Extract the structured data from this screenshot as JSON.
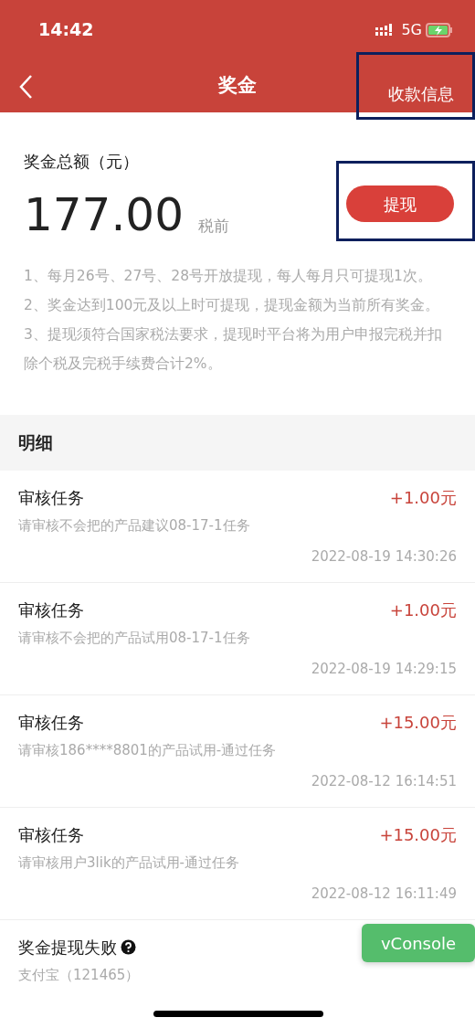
{
  "status_bar": {
    "time": "14:42",
    "network": "5G"
  },
  "nav": {
    "title": "奖金",
    "action": "收款信息",
    "action_highlighted": true
  },
  "summary": {
    "label": "奖金总额（元）",
    "amount": "177.00",
    "note": "税前",
    "button": "提现",
    "button_highlighted": true
  },
  "rules": [
    "1、每月26号、27号、28号开放提现，每人每月只可提现1次。",
    "2、奖金达到100元及以上时可提现，提现金额为当前所有奖金。",
    "3、提现须符合国家税法要求，提现时平台将为用户申报完税并扣除个税及完税手续费合计2%。"
  ],
  "details": {
    "heading": "明细",
    "items": [
      {
        "kind": "income",
        "title": "审核任务",
        "amount": "+1.00元",
        "desc": "请审核不会把的产品建议08-17-1任务",
        "time": "2022-08-19 14:30:26"
      },
      {
        "kind": "income",
        "title": "审核任务",
        "amount": "+1.00元",
        "desc": "请审核不会把的产品试用08-17-1任务",
        "time": "2022-08-19 14:29:15"
      },
      {
        "kind": "income",
        "title": "审核任务",
        "amount": "+15.00元",
        "desc": "请审核186****8801的产品试用-通过任务",
        "time": "2022-08-12 16:14:51"
      },
      {
        "kind": "income",
        "title": "审核任务",
        "amount": "+15.00元",
        "desc": "请审核用户3lik的产品试用-通过任务",
        "time": "2022-08-12 16:11:49"
      },
      {
        "kind": "failure",
        "title": "奖金提现失败",
        "desc": "支付宝（121465）"
      }
    ]
  },
  "floating_button": "vConsole"
}
